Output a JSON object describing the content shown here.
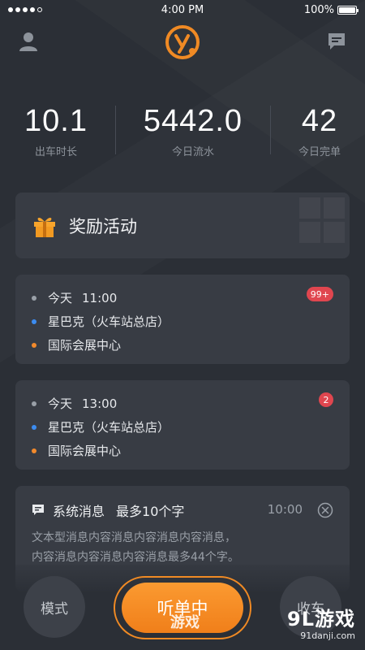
{
  "status_bar": {
    "time": "4:00 PM",
    "battery": "100%",
    "battery_level": 1.0,
    "signal_bars_filled": 4,
    "signal_bars_total": 5
  },
  "header": {
    "profile_icon": "user-icon",
    "message_icon": "chat-bubble-icon",
    "logo_letter": "y",
    "logo_color": "#f08a24"
  },
  "stats": [
    {
      "value": "10.1",
      "label": "出车时长"
    },
    {
      "value": "5442.0",
      "label": "今日流水"
    },
    {
      "value": "42",
      "label": "今日完单"
    }
  ],
  "reward": {
    "title": "奖励活动",
    "icon": "gift-icon"
  },
  "orders": [
    {
      "day": "今天",
      "time": "11:00",
      "pickup": "星巴克（火车站总店）",
      "destination": "国际会展中心",
      "badge": "99+"
    },
    {
      "day": "今天",
      "time": "13:00",
      "pickup": "星巴克（火车站总店）",
      "destination": "国际会展中心",
      "badge": "2"
    }
  ],
  "system_message": {
    "title": "系统消息",
    "subtitle": "最多10个字",
    "time": "10:00",
    "body_line1": "文本型消息内容消息内容消息内容消息，",
    "body_line2": "内容消息内容消息内容消息最多44个字。"
  },
  "bottom_bar": {
    "mode_label": "模式",
    "listen_label": "听单中",
    "collect_label": "收车"
  },
  "watermark": {
    "left_text": "游戏",
    "right_title": "9L游戏",
    "right_url": "91danji.com"
  },
  "colors": {
    "accent": "#f08a24",
    "background": "#2b2f36",
    "card": "#383c44",
    "badge": "#e0464f",
    "pickup_dot": "#3c8cf0",
    "destination_dot": "#f28a2c"
  }
}
